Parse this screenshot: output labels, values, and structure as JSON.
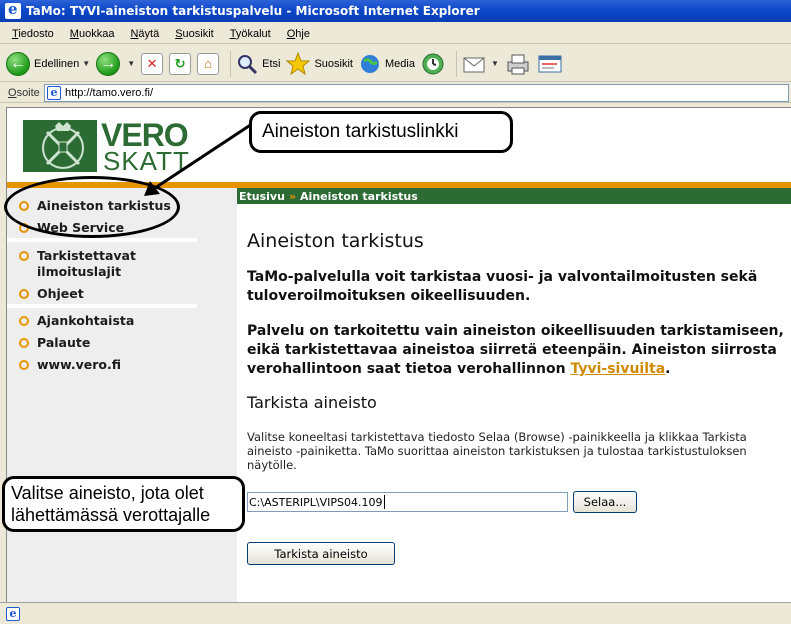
{
  "window": {
    "title": "TaMo: TYVI-aineiston tarkistuspalvelu - Microsoft Internet Explorer"
  },
  "menu": [
    "Tiedosto",
    "Muokkaa",
    "Näytä",
    "Suosikit",
    "Työkalut",
    "Ohje"
  ],
  "toolbar": {
    "back_label": "Edellinen",
    "search_label": "Etsi",
    "favorites_label": "Suosikit",
    "media_label": "Media"
  },
  "address": {
    "label": "Osoite",
    "url": "http://tamo.vero.fi/"
  },
  "logo": {
    "line1": "VERO",
    "line2": "SKATT"
  },
  "nav": {
    "items": [
      {
        "label": "Aineiston tarkistus"
      },
      {
        "label": "Web Service"
      },
      {
        "label": "Tarkistettavat ilmoituslajit"
      },
      {
        "label": "Ohjeet"
      },
      {
        "label": "Ajankohtaista"
      },
      {
        "label": "Palaute"
      },
      {
        "label": "www.vero.fi"
      }
    ]
  },
  "breadcrumb": {
    "home": "Etusivu",
    "separator": "»",
    "current": "Aineiston tarkistus"
  },
  "content": {
    "heading": "Aineiston tarkistus",
    "para1": "TaMo-palvelulla voit tarkistaa vuosi- ja valvontailmoitusten sekä tuloveroilmoituksen oikeellisuuden.",
    "para2_before": "Palvelu on tarkoitettu vain aineiston oikeellisuuden tarkistamiseen, eikä tarkistettavaa aineistoa siirretä eteenpäin. Aineiston siirrosta verohallintoon saat tietoa verohallinnon ",
    "para2_link": "Tyvi-sivuilta",
    "para2_after": ".",
    "subheading": "Tarkista aineisto",
    "para3": "Valitse koneeltasi tarkistettava tiedosto Selaa (Browse) -painikkeella ja klikkaa Tarkista aineisto -painiketta. TaMo suorittaa aineiston tarkistuksen ja tulostaa tarkistustuloksen näytölle.",
    "file_value": "C:\\ASTERIPL\\VIPS04.109",
    "browse_label": "Selaa...",
    "check_label": "Tarkista aineisto"
  },
  "annotations": {
    "top": "Aineiston tarkistuslinkki",
    "left": "Valitse aineisto, jota olet lähettämässä verottajalle"
  },
  "colors": {
    "brand_green": "#2d6b35",
    "accent_orange": "#e69500",
    "link": "#d08a00"
  }
}
